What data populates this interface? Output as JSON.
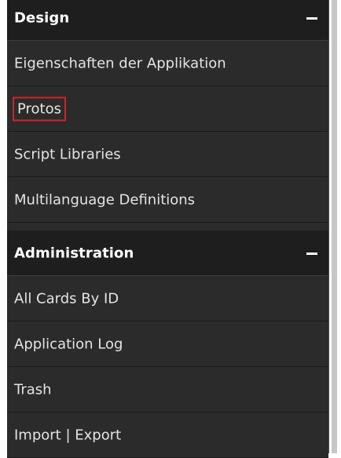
{
  "sections": {
    "design": {
      "title": "Design",
      "items": [
        {
          "label": "Eigenschaften der Applikation"
        },
        {
          "label": "Protos"
        },
        {
          "label": "Script Libraries"
        },
        {
          "label": "Multilanguage Definitions"
        }
      ]
    },
    "administration": {
      "title": "Administration",
      "items": [
        {
          "label": "All Cards By ID"
        },
        {
          "label": "Application Log"
        },
        {
          "label": "Trash"
        },
        {
          "label": "Import | Export"
        }
      ]
    }
  },
  "highlighted_item": "Protos",
  "colors": {
    "panel_bg": "#2b2b2b",
    "header_bg": "#1e1e1e",
    "text": "#e4e4e4",
    "highlight_border": "#c62828"
  },
  "icons": [
    "minus-icon"
  ]
}
